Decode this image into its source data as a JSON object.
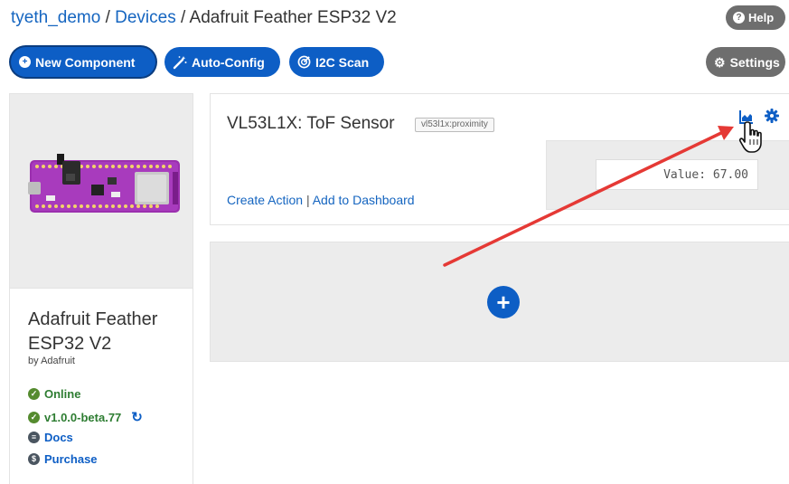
{
  "breadcrumb": {
    "user": "tyeth_demo",
    "devices": "Devices",
    "sep": "/",
    "current": "Adafruit Feather ESP32 V2"
  },
  "header": {
    "help_label": "Help",
    "help_icon": "?"
  },
  "toolbar": {
    "new_component_label": "New Component",
    "auto_config_label": "Auto-Config",
    "i2c_scan_label": "I2C Scan",
    "settings_label": "Settings",
    "plus_icon": "+"
  },
  "device": {
    "name": "Adafruit Feather ESP32 V2",
    "by": "by Adafruit",
    "status": "Online",
    "version": "v1.0.0-beta.77",
    "docs": "Docs",
    "purchase": "Purchase",
    "check_icon": "✓",
    "sync_icon": "↻",
    "purchase_icon": "$"
  },
  "component": {
    "title": "VL53L1X: ToF Sensor",
    "tag": "vl53l1x:proximity",
    "create_action": "Create Action",
    "link_separator": "|",
    "add_to_dashboard": "Add to Dashboard",
    "value": "Value: 67.00"
  },
  "add_card": {
    "plus": "+"
  },
  "colors": {
    "brand_blue": "#0d5ec5",
    "gray_button": "#6e6e6e",
    "online_green": "#2e7d32",
    "arrow_red": "#e53935"
  }
}
